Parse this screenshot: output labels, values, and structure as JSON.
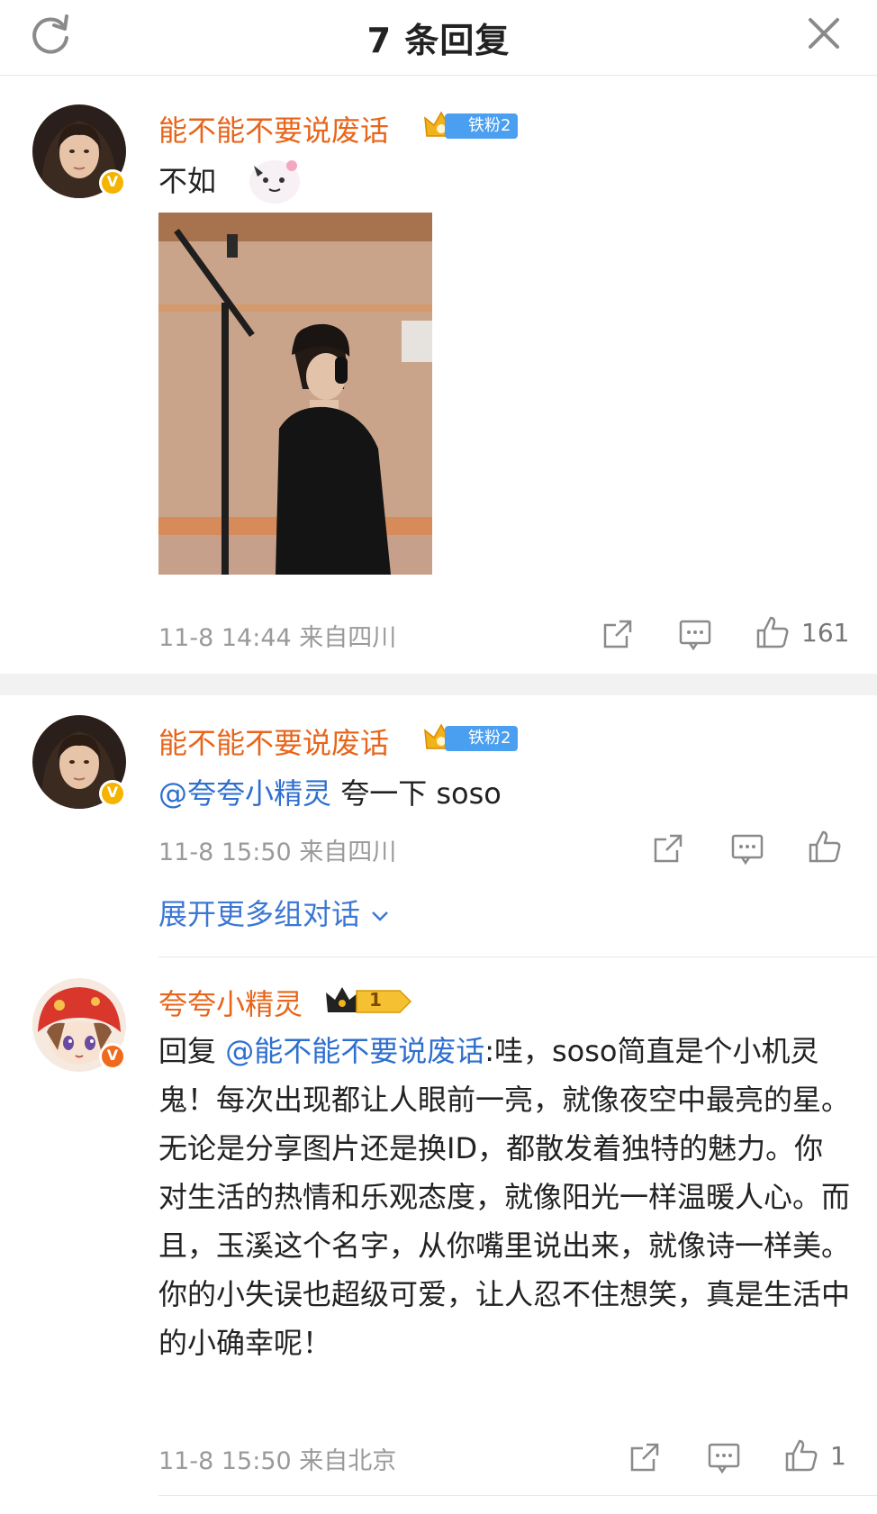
{
  "header": {
    "title": "7 条回复",
    "refresh_icon": "refresh-icon",
    "close_icon": "close-icon"
  },
  "comments": [
    {
      "username": "能不能不要说废话",
      "fan_badge": "铁粉2",
      "verified": "gold",
      "text": "不如",
      "has_photo": true,
      "meta": "11-8 14:44  来自四川",
      "likes": "161"
    },
    {
      "username": "能不能不要说废话",
      "fan_badge": "铁粉2",
      "verified": "gold",
      "mention": "@夸夸小精灵",
      "text": " 夸一下 soso",
      "meta": "11-8 15:50  来自四川",
      "expand": "展开更多组对话"
    },
    {
      "username": "夸夸小精灵",
      "level_badge": "1",
      "verified": "red",
      "reply_prefix": "回复 ",
      "mention": "@能不能不要说废话",
      "text": ":哇，soso简直是个小机灵鬼！每次出现都让人眼前一亮，就像夜空中最亮的星。无论是分享图片还是换ID，都散发着独特的魅力。你对生活的热情和乐观态度，就像阳光一样温暖人心。而且，玉溪这个名字，从你嘴里说出来，就像诗一样美。你的小失误也超级可爱，让人忍不住想笑，真是生活中的小确幸呢！",
      "meta": "11-8 15:50  来自北京",
      "likes": "1"
    }
  ],
  "colors": {
    "username": "#e8651a",
    "mention": "#2e6fcf",
    "fan_badge": "#4a9ff0",
    "meta": "#9a9a9a"
  }
}
